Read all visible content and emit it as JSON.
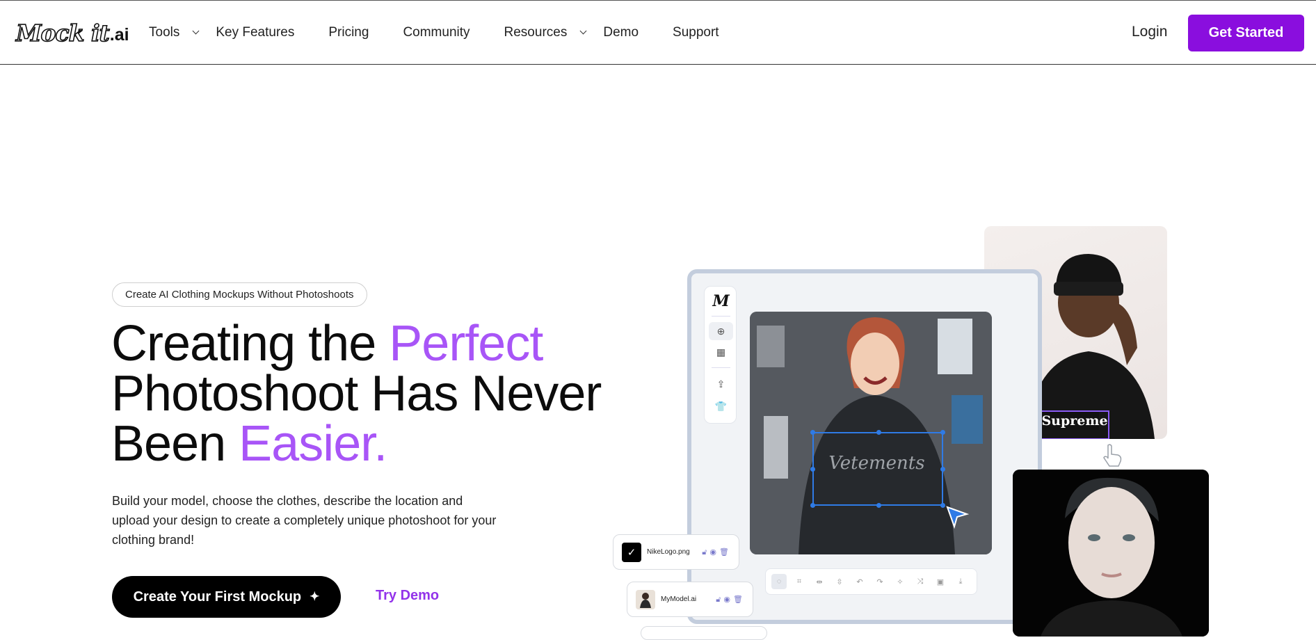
{
  "brand": {
    "logo_script": "Mock it",
    "logo_suffix": ".ai"
  },
  "nav": {
    "items": [
      {
        "label": "Tools",
        "dropdown": true
      },
      {
        "label": "Key Features",
        "dropdown": false
      },
      {
        "label": "Pricing",
        "dropdown": false
      },
      {
        "label": "Community",
        "dropdown": false
      },
      {
        "label": "Resources",
        "dropdown": true
      },
      {
        "label": "Demo",
        "dropdown": false
      },
      {
        "label": "Support",
        "dropdown": false
      }
    ],
    "login": "Login",
    "get_started": "Get Started"
  },
  "hero": {
    "badge": "Create AI Clothing Mockups Without Photoshoots",
    "headline": {
      "l1_plain": "Creating the ",
      "l1_accent": "Perfect",
      "l2": "Photoshoot Has Never",
      "l3_plain": "Been ",
      "l3_accent": "Easier."
    },
    "description": "Build your model, choose the clothes, describe the location and upload your design to create a completely unique photoshoot for your clothing brand!",
    "cta_primary": "Create Your First Mockup",
    "cta_secondary": "Try Demo"
  },
  "mockup": {
    "tool_logo": "M",
    "shirt_print_back": "Supreme",
    "shirt_print_main": "Vetements",
    "layers": [
      {
        "name": "NikeLogo.png"
      },
      {
        "name": "MyModel.ai"
      }
    ]
  },
  "colors": {
    "accent": "#a855f7",
    "brand_button": "#8a0ede",
    "selection": "#2f7be6"
  }
}
